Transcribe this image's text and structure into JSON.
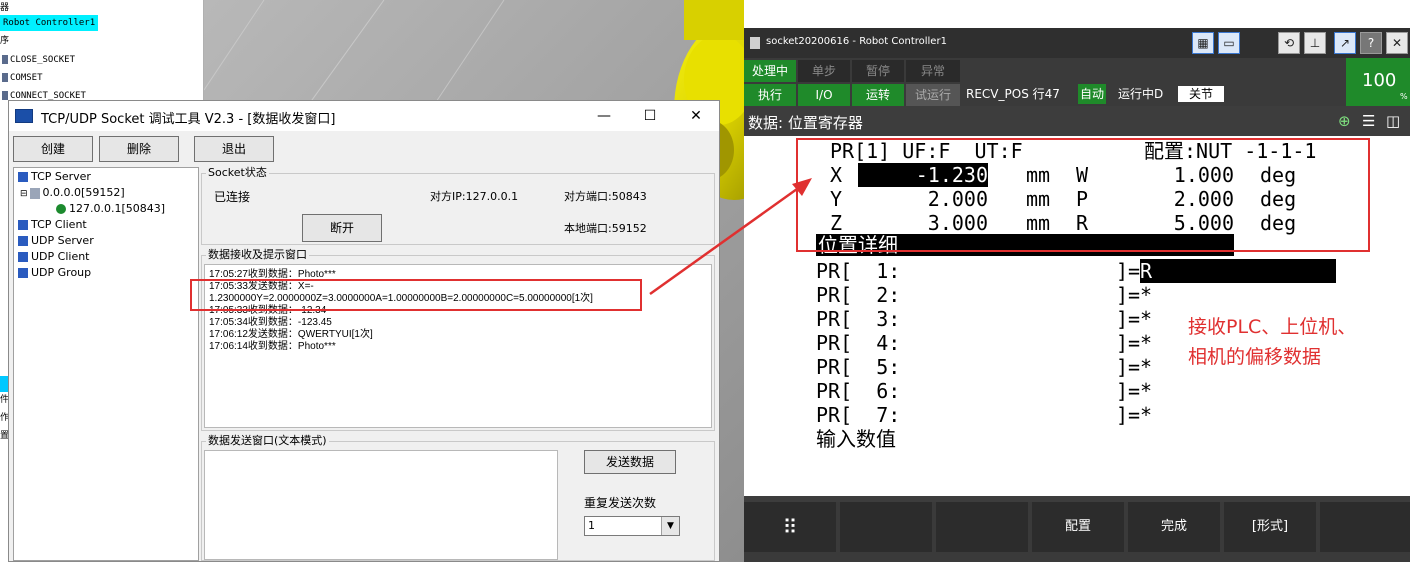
{
  "left_tree": {
    "items": [
      "器",
      "Robot Controller1",
      "序",
      "CLOSE_SOCKET",
      "COMSET",
      "CONNECT_SOCKET",
      "件",
      "作",
      "置"
    ]
  },
  "socket_tool": {
    "title": "TCP/UDP Socket 调试工具 V2.3 - [数据收发窗口]",
    "toolbar": {
      "create": "创建",
      "delete": "删除",
      "exit": "退出"
    },
    "tree": {
      "tcp_server": "TCP Server",
      "server_node": "0.0.0.0[59152]",
      "client_node": "127.0.0.1[50843]",
      "tcp_client": "TCP Client",
      "udp_server": "UDP Server",
      "udp_client": "UDP Client",
      "udp_group": "UDP Group"
    },
    "status": {
      "group_title": "Socket状态",
      "connected": "已连接",
      "peer_ip": "对方IP:127.0.0.1",
      "peer_port": "对方端口:50843",
      "local_port": "本地端口:59152",
      "disconnect": "断开"
    },
    "recv": {
      "group_title": "数据接收及提示窗口",
      "lines": [
        "17:05:27收到数据：Photo***",
        "17:05:33发送数据：X=-",
        "1.2300000Y=2.0000000Z=3.0000000A=1.00000000B=2.00000000C=5.00000000[1次]",
        "17:05:33收到数据：-12.34",
        "17:05:34收到数据：-123.45",
        "17:06:12发送数据：QWERTYUI[1次]",
        "17:06:14收到数据：Photo***"
      ]
    },
    "send": {
      "group_title": "数据发送窗口(文本模式)",
      "send_button": "发送数据",
      "repeat_label": "重复发送次数",
      "repeat_value": "1"
    }
  },
  "pendant": {
    "title": "socket20200616 - Robot Controller1",
    "status_row1": [
      "处理中",
      "单步",
      "暂停",
      "异常"
    ],
    "status_row2": [
      "执行",
      "I/O",
      "运转",
      "试运行"
    ],
    "program_status": "RECV_POS 行47",
    "mode": "自动",
    "run_state": "运行中D",
    "joint": "关节",
    "override": "100",
    "override_unit": "%",
    "header": "数据: 位置寄存器",
    "pr_header": "PR[1] UF:F  UT:F",
    "config": "配置:NUT -1-1-1",
    "pos_rows": [
      {
        "axis": "X",
        "value": "-1.230",
        "unit": "mm",
        "rot": "W",
        "rval": "1.000",
        "runit": "deg"
      },
      {
        "axis": "Y",
        "value": "2.000",
        "unit": "mm",
        "rot": "P",
        "rval": "2.000",
        "runit": "deg"
      },
      {
        "axis": "Z",
        "value": "3.000",
        "unit": "mm",
        "rot": "R",
        "rval": "5.000",
        "runit": "deg"
      }
    ],
    "detail_title": "位置详细",
    "pr_list": [
      {
        "label": "PR[  1:",
        "value": "R"
      },
      {
        "label": "PR[  2:",
        "value": "*"
      },
      {
        "label": "PR[  3:",
        "value": "*"
      },
      {
        "label": "PR[  4:",
        "value": "*"
      },
      {
        "label": "PR[  5:",
        "value": "*"
      },
      {
        "label": "PR[  6:",
        "value": "*"
      },
      {
        "label": "PR[  7:",
        "value": "*"
      }
    ],
    "prompt": "输入数值",
    "softkeys": [
      "",
      "",
      "",
      "配置",
      "完成",
      "[形式]",
      ""
    ]
  },
  "annotation": {
    "line1": "接收PLC、上位机、",
    "line2": "相机的偏移数据",
    "color": "#e03030"
  }
}
